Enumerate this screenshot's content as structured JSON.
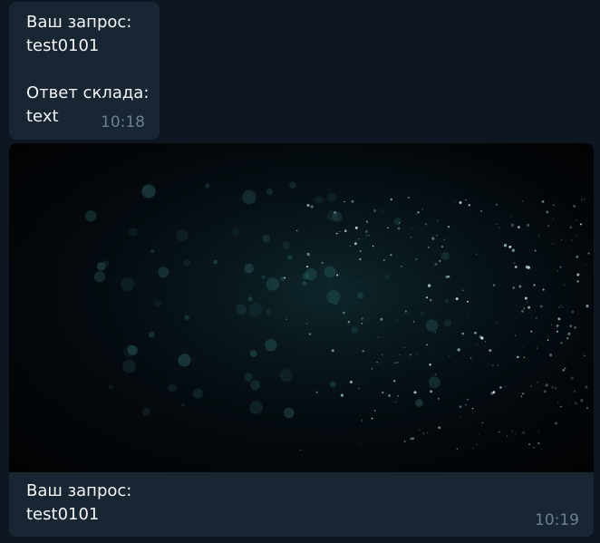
{
  "messages": [
    {
      "query_label": "Ваш запрос:",
      "query_value": "test0101",
      "answer_label": "Ответ склада:",
      "answer_value": "text",
      "time": "10:18"
    },
    {
      "media": "dark-particles-image",
      "query_label": "Ваш запрос:",
      "query_value": "test0101",
      "time": "10:19"
    }
  ]
}
